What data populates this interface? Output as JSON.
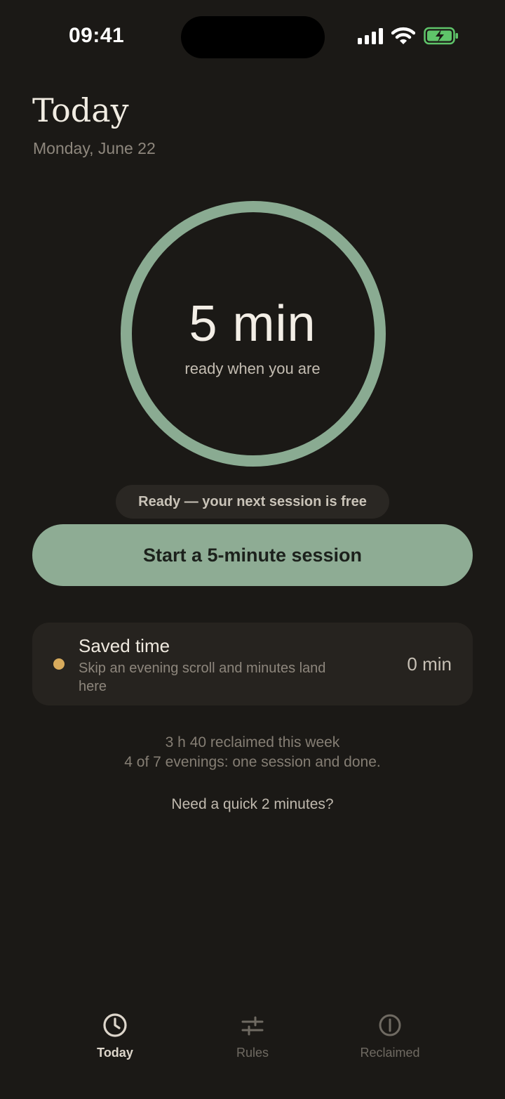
{
  "status_bar": {
    "time": "09:41"
  },
  "header": {
    "title": "Today",
    "date": "Monday, June 22"
  },
  "timer": {
    "value": "5 min",
    "caption": "ready when you are"
  },
  "status_pill": "Ready — your next session is free",
  "primary_button": "Start a 5-minute session",
  "saved_time": {
    "title": "Saved time",
    "description": "Skip an evening scroll and minutes land here",
    "value": "0 min"
  },
  "week_summary": {
    "line1": "3 h 40 reclaimed this week",
    "line2": "4 of 7 evenings: one session and done."
  },
  "quick_link": "Need a quick 2 minutes?",
  "tabs": [
    {
      "label": "Today",
      "icon": "clock-icon",
      "active": true
    },
    {
      "label": "Rules",
      "icon": "sliders-icon",
      "active": false
    },
    {
      "label": "Reclaimed",
      "icon": "shield-icon",
      "active": false
    }
  ],
  "colors": {
    "background": "#1b1916",
    "accent": "#8eac94",
    "dot": "#d8ab5c",
    "battery": "#5fc46a"
  }
}
